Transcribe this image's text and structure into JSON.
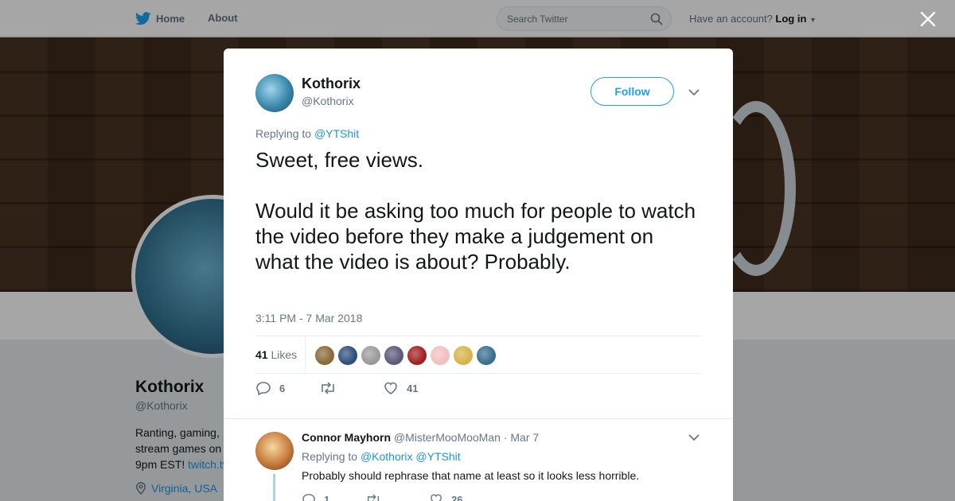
{
  "nav": {
    "home_label": "Home",
    "about_label": "About",
    "search_placeholder": "Search Twitter",
    "account_prompt": "Have an account?",
    "login_label": "Log in"
  },
  "profile": {
    "name": "Kothorix",
    "handle": "@Kothorix",
    "bio_line1": "Ranting, gaming,",
    "bio_line2": "stream games on",
    "bio_line3": "9pm EST!",
    "bio_link": "twitch.tv",
    "location": "Virginia, USA"
  },
  "tweet": {
    "author_name": "Kothorix",
    "author_handle": "@Kothorix",
    "follow_label": "Follow",
    "replying_prefix": "Replying to",
    "replying_to": "@YTShit",
    "text_p1": "Sweet, free views.",
    "text_p2": "Would it be asking too much for people to watch the video before they make a judgement on what the video is about? Probably.",
    "timestamp": "3:11 PM - 7 Mar 2018",
    "likes_count": "41",
    "likes_label": "Likes",
    "reply_count": "6",
    "retweet_count": "",
    "like_count": "41",
    "liker_colors": [
      "#8a6a3a",
      "#2f4f7a",
      "#9a9a9a",
      "#5a5a7a",
      "#a32020",
      "#f0c0c0",
      "#d9b24a",
      "#3a6f8f"
    ]
  },
  "reply": {
    "author_name": "Connor Mayhorn",
    "author_handle": "@MisterMooMooMan",
    "date": "· Mar 7",
    "replying_prefix": "Replying to",
    "replying_to_1": "@Kothorix",
    "replying_to_2": "@YTShit",
    "text": "Probably should rephrase that name at least so it looks less horrible.",
    "reply_count": "1",
    "like_count": "26"
  },
  "colors": {
    "accent": "#1da1f2",
    "link": "#1b95e0",
    "muted": "#657786"
  }
}
